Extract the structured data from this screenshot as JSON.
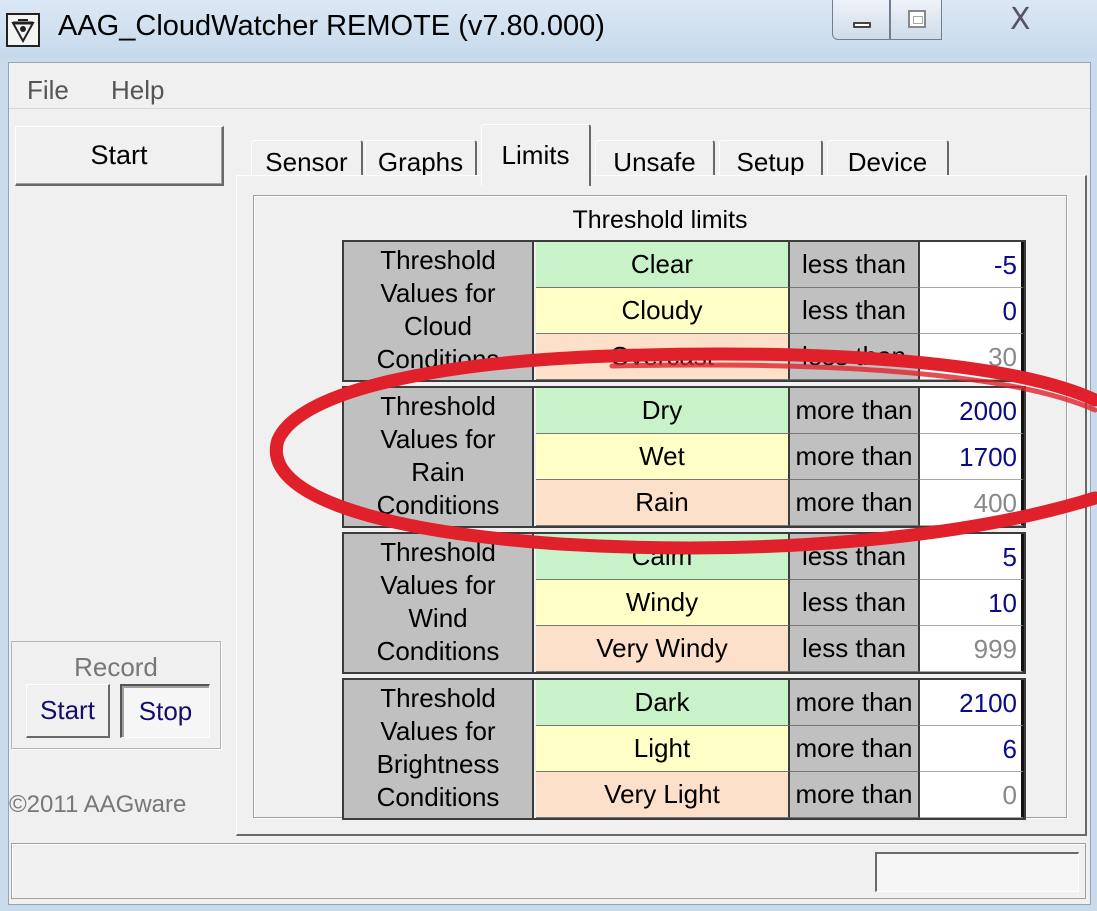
{
  "window": {
    "title": "AAG_CloudWatcher REMOTE (v7.80.000)",
    "close_glyph": "X"
  },
  "menu": {
    "file": "File",
    "help": "Help"
  },
  "left_panel": {
    "start_label": "Start",
    "record": {
      "label": "Record",
      "start_label": "Start",
      "stop_label": "Stop"
    },
    "copyright": "©2011 AAGware"
  },
  "tabs": [
    {
      "label": "Sensor"
    },
    {
      "label": "Graphs"
    },
    {
      "label": "Limits",
      "active": true
    },
    {
      "label": "Unsafe"
    },
    {
      "label": "Setup"
    },
    {
      "label": "Device"
    }
  ],
  "limits": {
    "title": "Threshold limits",
    "groups": [
      {
        "title": "Threshold\nValues for\nCloud\nConditions",
        "rows": [
          {
            "condition": "Clear",
            "comparator": "less than",
            "value": "-5"
          },
          {
            "condition": "Cloudy",
            "comparator": "less than",
            "value": "0"
          },
          {
            "condition": "Overcast",
            "comparator": "less than",
            "value": "30"
          }
        ]
      },
      {
        "title": "Threshold\nValues for\nRain\nConditions",
        "rows": [
          {
            "condition": "Dry",
            "comparator": "more than",
            "value": "2000"
          },
          {
            "condition": "Wet",
            "comparator": "more than",
            "value": "1700"
          },
          {
            "condition": "Rain",
            "comparator": "more than",
            "value": "400"
          }
        ]
      },
      {
        "title": "Threshold\nValues for\nWind\nConditions",
        "rows": [
          {
            "condition": "Calm",
            "comparator": "less than",
            "value": "5"
          },
          {
            "condition": "Windy",
            "comparator": "less than",
            "value": "10"
          },
          {
            "condition": "Very Windy",
            "comparator": "less than",
            "value": "999"
          }
        ]
      },
      {
        "title": "Threshold\nValues for\nBrightness\nConditions",
        "rows": [
          {
            "condition": "Dark",
            "comparator": "more than",
            "value": "2100"
          },
          {
            "condition": "Light",
            "comparator": "more than",
            "value": "6"
          },
          {
            "condition": "Very Light",
            "comparator": "more than",
            "value": "0"
          }
        ]
      }
    ]
  },
  "colors": {
    "row_1": "#c8f2c8",
    "row_2": "#ffffc6",
    "row_3": "#fde0c9",
    "annotation": "#e0202a",
    "value_text": "#0b0b8a"
  },
  "statusbar": {
    "text": ""
  }
}
